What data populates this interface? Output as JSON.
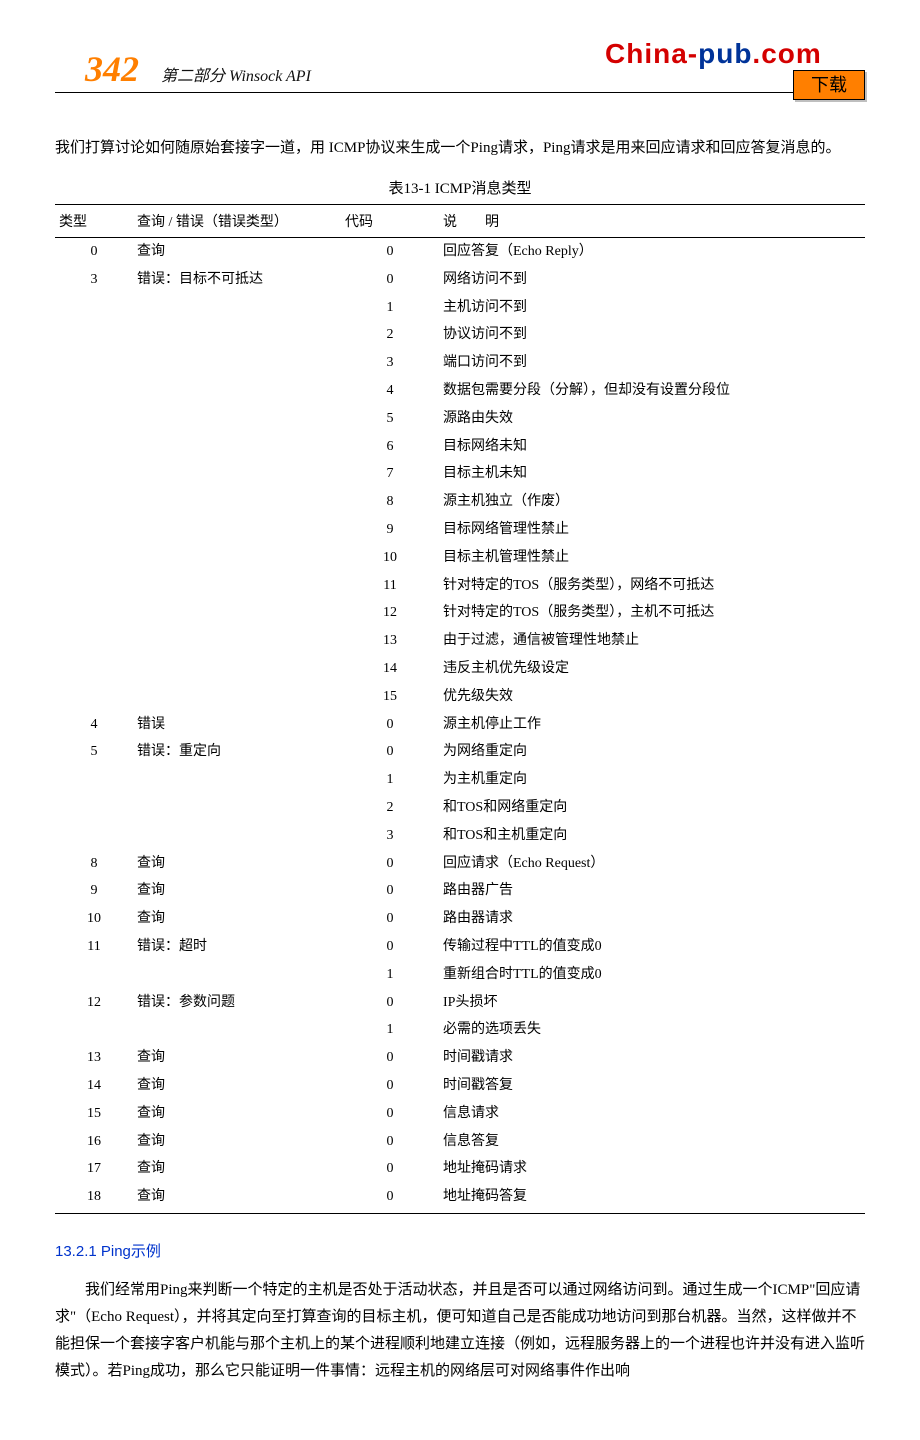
{
  "header": {
    "page_num": "342",
    "section": "第二部分    Winsock API",
    "logo_china": "China-",
    "logo_pub": "pub",
    "logo_com": ".com",
    "download": "下载"
  },
  "intro": "我们打算讨论如何随原始套接字一道，用 ICMP协议来生成一个Ping请求，Ping请求是用来回应请求和回应答复消息的。",
  "table_caption": "表13-1   ICMP消息类型",
  "table_headers": {
    "type": "类型",
    "qe": "查询 / 错误（错误类型）",
    "code": "代码",
    "desc": "说明"
  },
  "rows": [
    {
      "type": "0",
      "qe": "查询",
      "code": "0",
      "desc": "回应答复（Echo Reply）"
    },
    {
      "type": "3",
      "qe": "错误：目标不可抵达",
      "code": "0",
      "desc": "网络访问不到"
    },
    {
      "type": "",
      "qe": "",
      "code": "1",
      "desc": "主机访问不到"
    },
    {
      "type": "",
      "qe": "",
      "code": "2",
      "desc": "协议访问不到"
    },
    {
      "type": "",
      "qe": "",
      "code": "3",
      "desc": "端口访问不到"
    },
    {
      "type": "",
      "qe": "",
      "code": "4",
      "desc": "数据包需要分段（分解），但却没有设置分段位"
    },
    {
      "type": "",
      "qe": "",
      "code": "5",
      "desc": "源路由失效"
    },
    {
      "type": "",
      "qe": "",
      "code": "6",
      "desc": "目标网络未知"
    },
    {
      "type": "",
      "qe": "",
      "code": "7",
      "desc": "目标主机未知"
    },
    {
      "type": "",
      "qe": "",
      "code": "8",
      "desc": "源主机独立（作废）"
    },
    {
      "type": "",
      "qe": "",
      "code": "9",
      "desc": "目标网络管理性禁止"
    },
    {
      "type": "",
      "qe": "",
      "code": "10",
      "desc": "目标主机管理性禁止"
    },
    {
      "type": "",
      "qe": "",
      "code": "11",
      "desc": "针对特定的TOS（服务类型），网络不可抵达"
    },
    {
      "type": "",
      "qe": "",
      "code": "12",
      "desc": "针对特定的TOS（服务类型），主机不可抵达"
    },
    {
      "type": "",
      "qe": "",
      "code": "13",
      "desc": "由于过滤，通信被管理性地禁止"
    },
    {
      "type": "",
      "qe": "",
      "code": "14",
      "desc": "违反主机优先级设定"
    },
    {
      "type": "",
      "qe": "",
      "code": "15",
      "desc": "优先级失效"
    },
    {
      "type": "4",
      "qe": "错误",
      "code": "0",
      "desc": "源主机停止工作"
    },
    {
      "type": "5",
      "qe": "错误：重定向",
      "code": "0",
      "desc": "为网络重定向"
    },
    {
      "type": "",
      "qe": "",
      "code": "1",
      "desc": "为主机重定向"
    },
    {
      "type": "",
      "qe": "",
      "code": "2",
      "desc": "和TOS和网络重定向"
    },
    {
      "type": "",
      "qe": "",
      "code": "3",
      "desc": "和TOS和主机重定向"
    },
    {
      "type": "8",
      "qe": "查询",
      "code": "0",
      "desc": "回应请求（Echo Request）"
    },
    {
      "type": "9",
      "qe": "查询",
      "code": "0",
      "desc": "路由器广告"
    },
    {
      "type": "10",
      "qe": "查询",
      "code": "0",
      "desc": "路由器请求"
    },
    {
      "type": "11",
      "qe": "错误：超时",
      "code": "0",
      "desc": "传输过程中TTL的值变成0"
    },
    {
      "type": "",
      "qe": "",
      "code": "1",
      "desc": "重新组合时TTL的值变成0"
    },
    {
      "type": "12",
      "qe": "错误：参数问题",
      "code": "0",
      "desc": "IP头损坏"
    },
    {
      "type": "",
      "qe": "",
      "code": "1",
      "desc": "必需的选项丢失"
    },
    {
      "type": "13",
      "qe": "查询",
      "code": "0",
      "desc": "时间戳请求"
    },
    {
      "type": "14",
      "qe": "查询",
      "code": "0",
      "desc": "时间戳答复"
    },
    {
      "type": "15",
      "qe": "查询",
      "code": "0",
      "desc": "信息请求"
    },
    {
      "type": "16",
      "qe": "查询",
      "code": "0",
      "desc": "信息答复"
    },
    {
      "type": "17",
      "qe": "查询",
      "code": "0",
      "desc": "地址掩码请求"
    },
    {
      "type": "18",
      "qe": "查询",
      "code": "0",
      "desc": "地址掩码答复"
    }
  ],
  "section_heading": "13.2.1   Ping示例",
  "body": "我们经常用Ping来判断一个特定的主机是否处于活动状态，并且是否可以通过网络访问到。通过生成一个ICMP\"回应请求\"（Echo Request），并将其定向至打算查询的目标主机，便可知道自己是否能成功地访问到那台机器。当然，这样做并不能担保一个套接字客户机能与那个主机上的某个进程顺利地建立连接（例如，远程服务器上的一个进程也许并没有进入监听模式）。若Ping成功，那么它只能证明一件事情：远程主机的网络层可对网络事件作出响"
}
